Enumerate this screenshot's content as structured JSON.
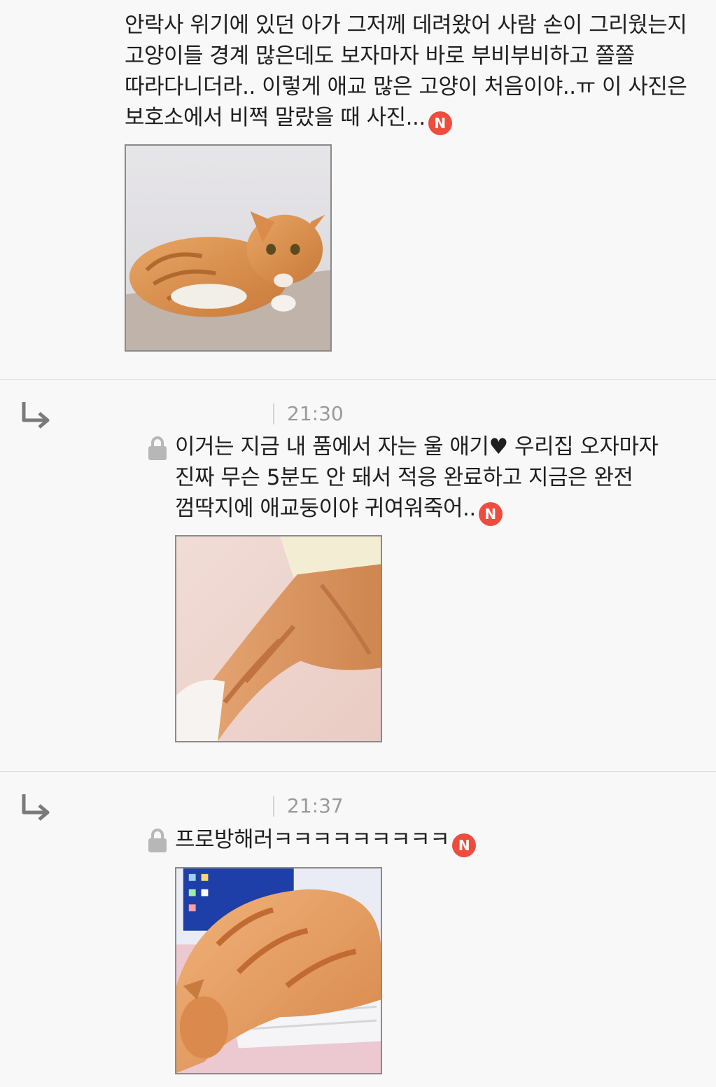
{
  "comments": [
    {
      "text": "안락사 위기에 있던 아가 그저께 데려왔어 사람 손이 그리웠는지 고양이들 경계 많은데도 보자마자 바로 부비부비하고 쫄쫄 따라다니더라.. 이렇게 애교 많은 고양이 처음이야..ㅠ 이 사진은 보호소에서 비쩍 말랐을 때 사진...",
      "badge": "N",
      "icon": "new-badge"
    },
    {
      "time": "21:30",
      "text": "이거는 지금 내 품에서 자는 울 애기♥ 우리집 오자마자 진짜 무슨 5분도 안 돼서 적응 완료하고 지금은 완전 껌딱지에 애교둥이야 귀여워죽어..",
      "badge": "N",
      "secret": true,
      "icon": "reply-arrow-icon"
    },
    {
      "time": "21:37",
      "text": "프로방해러ㅋㅋㅋㅋㅋㅋㅋㅋㅋ",
      "badge": "N",
      "secret": true,
      "icon": "reply-arrow-icon"
    }
  ],
  "colors": {
    "background": "#f8f8f8",
    "new_badge": "#ee4d3d",
    "timestamp": "#9a9a9a",
    "divider": "#dcdcdc"
  }
}
